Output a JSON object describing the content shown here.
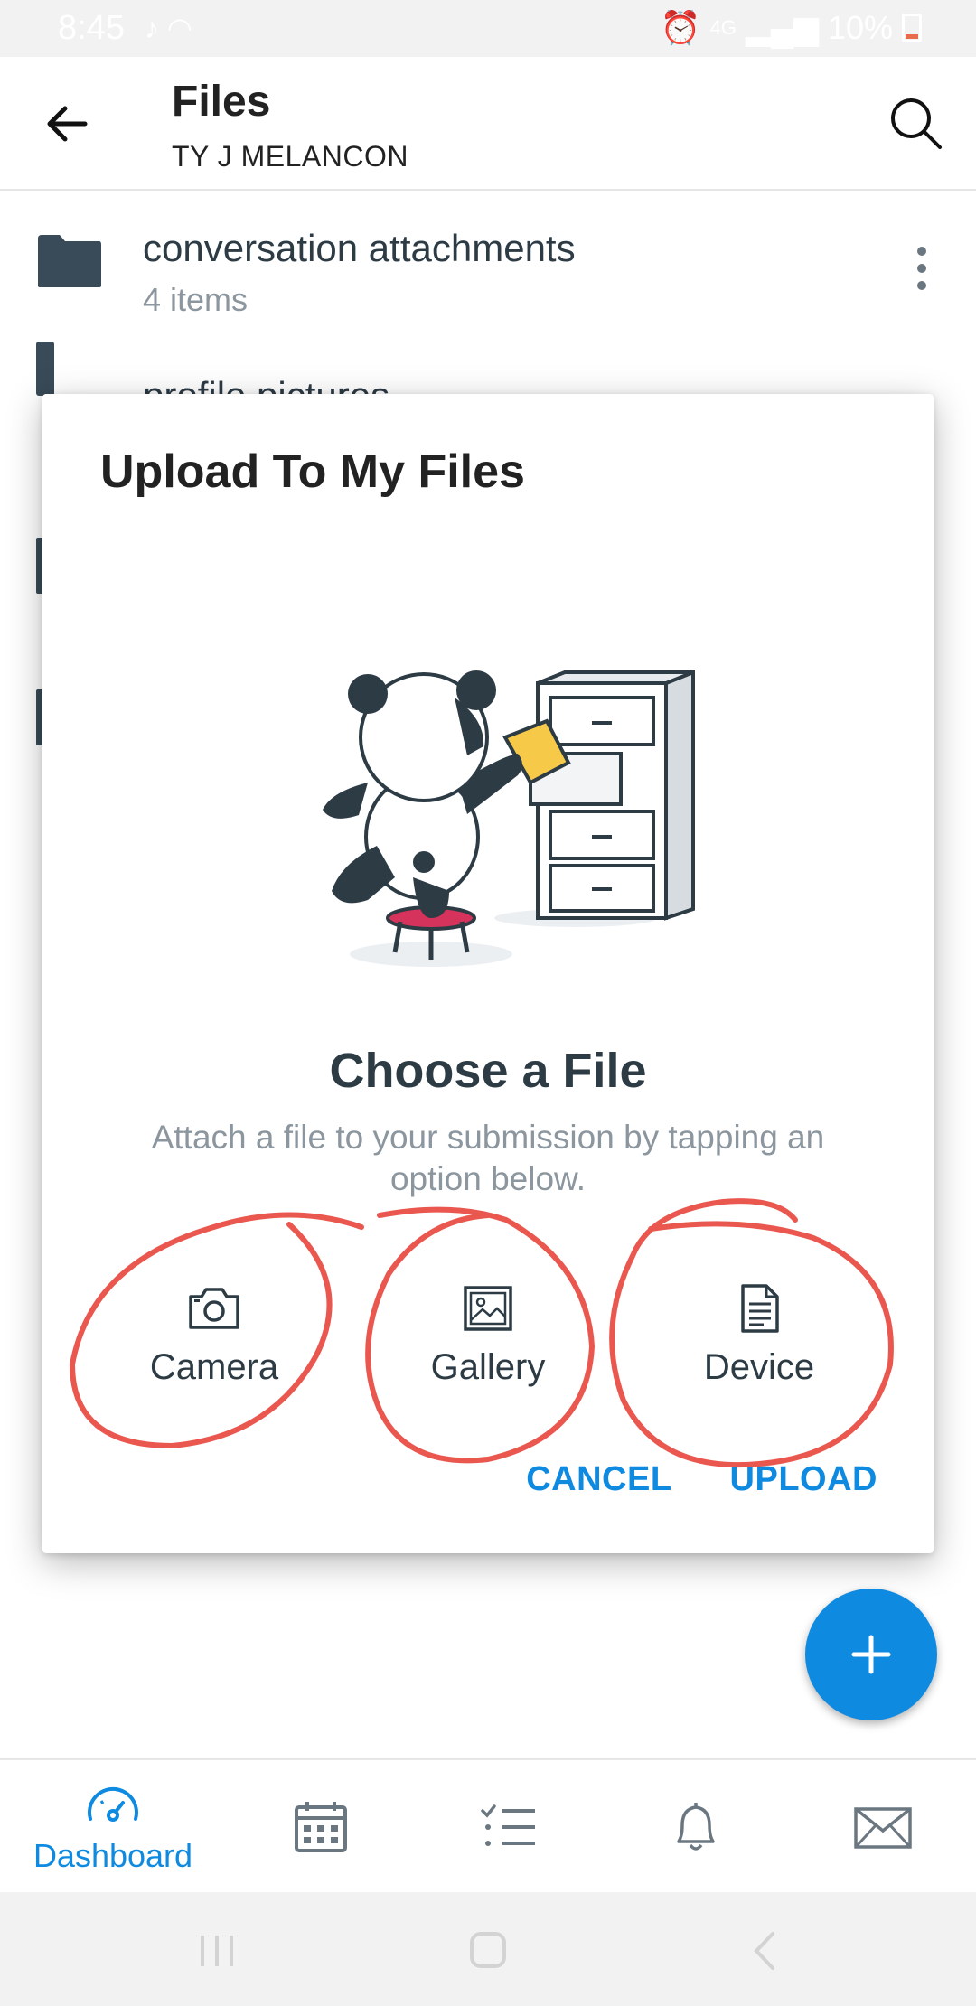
{
  "status_bar": {
    "time": "8:45",
    "network": "4G",
    "battery": "10%"
  },
  "header": {
    "title": "Files",
    "subtitle": "TY J MELANCON"
  },
  "file_list": [
    {
      "name": "conversation attachments",
      "count": "4 items"
    },
    {
      "name": "profile pictures"
    }
  ],
  "dialog": {
    "title": "Upload To My Files",
    "choose_title": "Choose a File",
    "choose_description": "Attach a file to your submission by tapping an option below.",
    "options": [
      {
        "label": "Camera",
        "icon": "camera-icon"
      },
      {
        "label": "Gallery",
        "icon": "gallery-icon"
      },
      {
        "label": "Device",
        "icon": "document-icon"
      }
    ],
    "cancel_label": "CANCEL",
    "upload_label": "UPLOAD"
  },
  "fab": {
    "icon": "plus-icon"
  },
  "bottom_nav": {
    "items": [
      {
        "label": "Dashboard",
        "icon": "dashboard-icon",
        "active": true
      },
      {
        "icon": "calendar-icon"
      },
      {
        "icon": "todo-list-icon"
      },
      {
        "icon": "bell-icon"
      },
      {
        "icon": "mail-icon"
      }
    ]
  },
  "colors": {
    "accent": "#0e8ae0",
    "text_primary": "#2d3b45",
    "text_secondary": "#8b969e",
    "annotation": "#e8453c"
  }
}
